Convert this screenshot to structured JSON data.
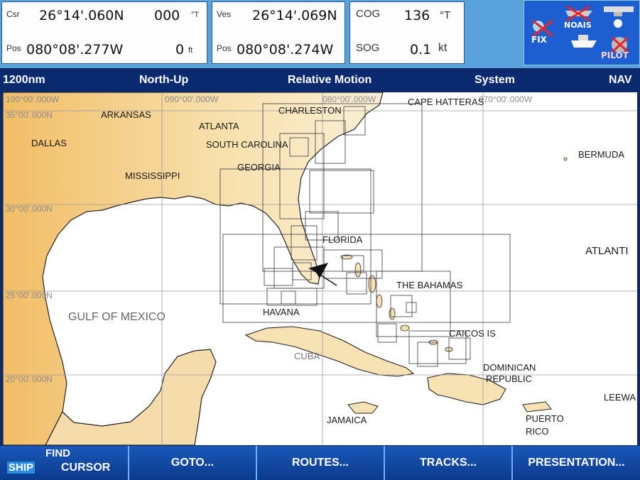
{
  "cursor": {
    "label": "Csr",
    "lat": "26°14'.060N",
    "pos_label": "Pos",
    "lon": "080°08'.277W",
    "bearing": "000",
    "bearing_unit": "°T",
    "range": "0",
    "range_unit": "ft"
  },
  "vessel": {
    "label": "Ves",
    "lat": "26°14'.069N",
    "pos_label": "Pos",
    "lon": "080°08'.274W"
  },
  "nav": {
    "cog_label": "COG",
    "cog": "136",
    "cog_unit": "°T",
    "sog_label": "SOG",
    "sog": "0.1",
    "sog_unit": "kt"
  },
  "status_icons": {
    "fix": "FIX",
    "noais": "NOAIS",
    "pilot": "PILOT"
  },
  "status": {
    "range": "1200nm",
    "orientation": "North-Up",
    "motion": "Relative Motion",
    "mode": "System",
    "nav": "NAV"
  },
  "map": {
    "grid_lon": [
      "100°00'.000W",
      "090°00'.000W",
      "080°00'.000W",
      "070°00'.000W"
    ],
    "grid_lat": [
      "35°00'.000N",
      "30°00'.000N",
      "25°00'.000N",
      "20°00'.000N"
    ],
    "places": [
      "ARKANSAS",
      "DALLAS",
      "ATLANTA",
      "CHARLESTON",
      "CAPE HATTERAS",
      "SOUTH CAROLINA",
      "GEORGIA",
      "MISSISSIPPI",
      "BERMUDA",
      "FLORIDA",
      "ATLANTI",
      "THE BAHAMAS",
      "GULF OF MEXICO",
      "HAVANA",
      "CAICOS IS",
      "CUBA",
      "DOMINICAN",
      "REPUBLIC",
      "LEEWA",
      "JAMAICA",
      "PUERTO",
      "RICO"
    ],
    "colors": {
      "land": "#f5dcaa",
      "land_west": "#f1b860",
      "water": "#ffffff",
      "grid": "#9a9aa0",
      "charts": "#3a3a44"
    }
  },
  "softkeys": {
    "ship": "SHIP",
    "find": "FIND",
    "cursor": "CURSOR",
    "goto": "GOTO...",
    "routes": "ROUTES...",
    "tracks": "TRACKS...",
    "presentation": "PRESENTATION..."
  }
}
